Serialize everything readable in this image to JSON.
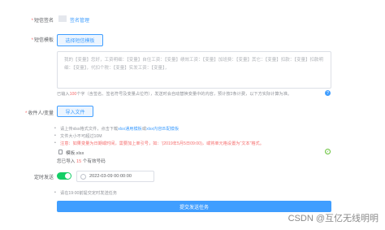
{
  "sign": {
    "label": "短信签名",
    "value": "签名管理"
  },
  "template": {
    "label": "短信模板",
    "button": "选择短信模板",
    "content": "我的【变量】您好，工资明细：【变量】自住工资：【变量】绩效工资：【变量】加班费：【变量】其它：【变量】扣款：【变量】扣款明细：【变量】，代扣个税：【变量】实发工资：【变量】，",
    "counter_prefix": "已输入",
    "counter_value": "100",
    "counter_suffix": "个字（含签名、签名符号及变量占位符），发送时会自动替换变量中的内容，预计按2条计费，以下方实际计算为准。"
  },
  "receiver": {
    "label": "收件人/变量",
    "import_button": "导入文件",
    "tip1_prefix": "请上传xlsx格式文件，点击下载",
    "tip1_link1": "xlsx通用模板",
    "tip1_mid": "或",
    "tip1_link2": "xlsx内容匹配模板",
    "tip2": "文件大小不可超过10M",
    "tip3": "注意：如果变量为日期或时间，需要加上单引号，如：'(2019年5月5日09:00)，或将单元格设置为“文本”格式。",
    "file_name": "模板.xlsx",
    "count_prefix": "您已导入",
    "count_value": "15",
    "count_suffix": "个有效号码"
  },
  "schedule": {
    "label": "定时发送",
    "enabled": true,
    "datetime": "2022-03-09 00:00:00",
    "hint": "请在19:00前提交定时发送任务"
  },
  "submit": {
    "label": "提交发送任务"
  },
  "watermark": "CSDN @互亿无线明明"
}
